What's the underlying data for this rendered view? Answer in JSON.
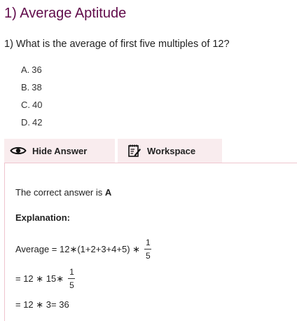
{
  "header": {
    "title": "1) Average Aptitude"
  },
  "question": {
    "text": "1) What is the average of first five multiples of 12?",
    "options": [
      {
        "letter": "A.",
        "value": "36"
      },
      {
        "letter": "B.",
        "value": "38"
      },
      {
        "letter": "C.",
        "value": "40"
      },
      {
        "letter": "D.",
        "value": "42"
      }
    ]
  },
  "tabs": {
    "hide_answer": {
      "label": "Hide Answer",
      "icon": "eye-icon"
    },
    "workspace": {
      "label": "Workspace",
      "icon": "notepad-pencil-icon"
    }
  },
  "answer": {
    "correct_prefix": "The correct answer is",
    "correct_letter": "A",
    "explanation_heading": "Explanation:",
    "line1_text": "Average = 12∗(1+2+3+4+5) ∗",
    "line1_frac_num": "1",
    "line1_frac_den": "5",
    "line2_text": "= 12 ∗ 15∗",
    "line2_frac_num": "1",
    "line2_frac_den": "5",
    "line3_text": "= 12 ∗ 3= 36"
  },
  "colors": {
    "title": "#610b4b",
    "tab_background": "#f9ecee",
    "answer_border": "#efc5ce"
  }
}
